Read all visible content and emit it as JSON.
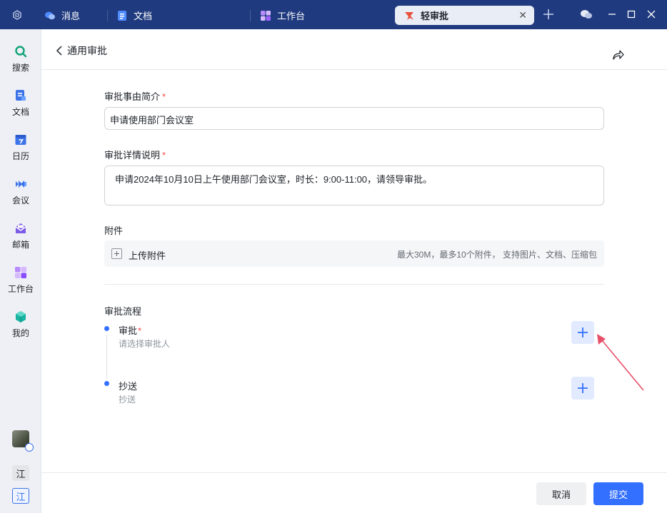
{
  "titlebar": {
    "tabs": [
      {
        "label": "消息",
        "icon": "chat-icon"
      },
      {
        "label": "文档",
        "icon": "doc-icon"
      },
      {
        "label": "工作台",
        "icon": "workbench-icon"
      }
    ],
    "active_tab": {
      "label": "轻审批",
      "icon": "approval-icon"
    },
    "accent": "#1f3a7e"
  },
  "sidebar": {
    "items": [
      {
        "label": "搜索",
        "icon": "search-icon"
      },
      {
        "label": "文档",
        "icon": "doc-icon"
      },
      {
        "label": "日历",
        "icon": "calendar-icon"
      },
      {
        "label": "会议",
        "icon": "meeting-icon"
      },
      {
        "label": "邮箱",
        "icon": "mail-icon"
      },
      {
        "label": "工作台",
        "icon": "workbench-icon"
      },
      {
        "label": "我的",
        "icon": "cube-icon"
      }
    ],
    "org_1": "江",
    "org_2": "江"
  },
  "header": {
    "back_label": "通用审批"
  },
  "form": {
    "reason_label": "审批事由简介",
    "reason_value": "申请使用部门会议室",
    "detail_label": "审批详情说明",
    "detail_value": "申请2024年10月10日上午使用部门会议室，时长：9:00-11:00，请领导审批。",
    "required_mark": "*",
    "attachment_label": "附件",
    "upload_label": "上传附件",
    "upload_hint": "最大30M，最多10个附件， 支持图片、文档、压缩包"
  },
  "flow": {
    "title": "审批流程",
    "steps": [
      {
        "title": "审批",
        "required": "*",
        "subtitle": "请选择审批人"
      },
      {
        "title": "抄送",
        "required": "",
        "subtitle": "抄送"
      }
    ]
  },
  "footer": {
    "cancel_label": "取消",
    "submit_label": "提交"
  },
  "colors": {
    "primary": "#3370ff",
    "required": "#f54a45",
    "annotation_arrow": "#e8506a"
  }
}
